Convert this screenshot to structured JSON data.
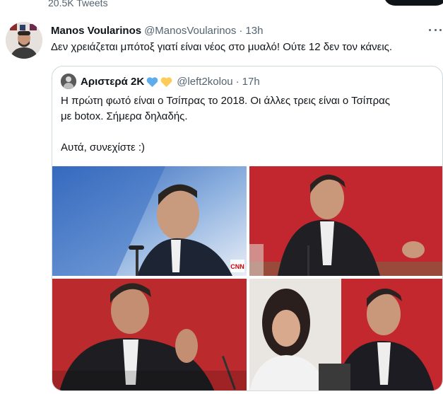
{
  "header_strip": {
    "tweet_count": "20.5K Tweets"
  },
  "tweet": {
    "display_name": "Manos Voularinos",
    "handle": "@ManosVoularinos",
    "separator": "·",
    "time": "13h",
    "text": "Δεν χρειάζεται μπότοξ γιατί είναι νέος στο μυαλό! Ούτε 12 δεν τον κάνεις."
  },
  "quoted_tweet": {
    "display_name": "Αριστερά 2Κ",
    "emojis": [
      "blue-heart-icon",
      "yellow-heart-icon"
    ],
    "handle": "@left2kolou",
    "separator": "·",
    "time": "17h",
    "text_lines": [
      "Η πρώτη φωτό είναι ο Τσίπρας το 2018. Οι άλλες τρεις είναι ο Τσίπρας",
      "με botox. Σήμερα δηλαδής.",
      "",
      "Αυτά, συνεχίστε :)"
    ],
    "photos": [
      {
        "name": "photo-1",
        "watermark": "CNN Greece"
      },
      {
        "name": "photo-2"
      },
      {
        "name": "photo-3"
      },
      {
        "name": "photo-4"
      }
    ]
  },
  "colors": {
    "text_primary": "#0f1419",
    "text_secondary": "#536471",
    "border": "#cfd9de",
    "heart_blue": "#5dadec",
    "heart_yellow": "#fdcb58"
  }
}
